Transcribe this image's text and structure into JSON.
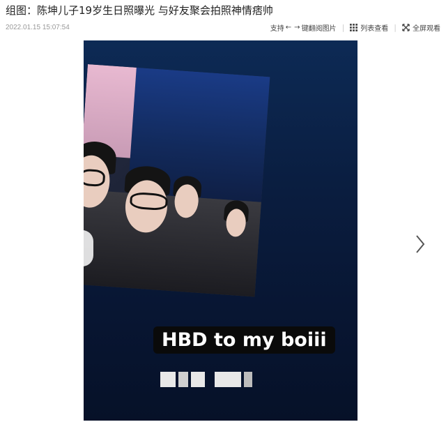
{
  "header": {
    "title": "组图：陈坤儿子19岁生日照曝光 与好友聚会拍照神情痞帅",
    "timestamp": "2022.01.15 15:07:54"
  },
  "toolbar": {
    "support_label": "支持",
    "arrow_left": "←",
    "arrow_right": "→",
    "keyboard_label": "键翻阅图片",
    "list_label": "列表查看",
    "fullscreen_label": "全屏观看"
  },
  "photo": {
    "caption": "HBD to my boiii"
  },
  "colors": {
    "viewer_bg": "#0a1d3f",
    "caption_bg": "#0a0a0a"
  }
}
